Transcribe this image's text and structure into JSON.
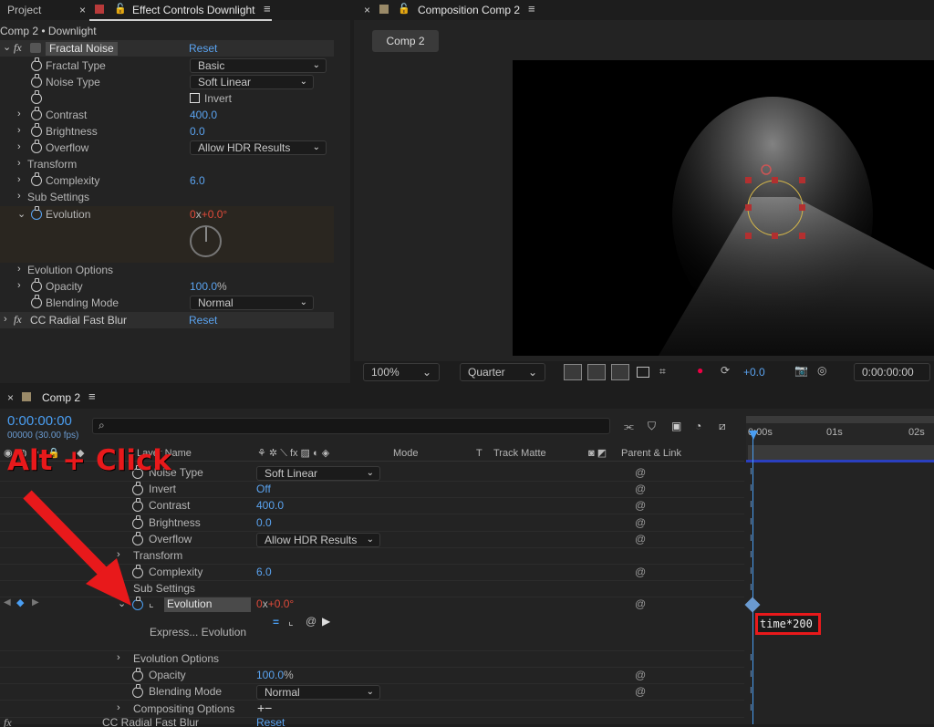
{
  "tabs": {
    "project": "Project",
    "effect_controls": "Effect Controls Downlight",
    "composition": "Composition Comp 2",
    "comp_button": "Comp 2",
    "timeline": "Comp 2"
  },
  "effect_panel": {
    "breadcrumb": "Comp 2 • Downlight",
    "effect1_name": "Fractal Noise",
    "reset": "Reset",
    "rows": {
      "fractal_type": {
        "label": "Fractal Type",
        "value": "Basic"
      },
      "noise_type": {
        "label": "Noise Type",
        "value": "Soft Linear"
      },
      "invert": {
        "label": "Invert"
      },
      "contrast": {
        "label": "Contrast",
        "value": "400.0"
      },
      "brightness": {
        "label": "Brightness",
        "value": "0.0"
      },
      "overflow": {
        "label": "Overflow",
        "value": "Allow HDR Results"
      },
      "transform": {
        "label": "Transform"
      },
      "complexity": {
        "label": "Complexity",
        "value": "6.0"
      },
      "sub_settings": {
        "label": "Sub Settings"
      },
      "evolution": {
        "label": "Evolution",
        "value_rev": "0",
        "value_x": "x",
        "value_deg": "+0.0°"
      },
      "evolution_options": {
        "label": "Evolution Options"
      },
      "opacity": {
        "label": "Opacity",
        "value": "100.0",
        "unit": "%"
      },
      "blending_mode": {
        "label": "Blending Mode",
        "value": "Normal"
      }
    },
    "effect2_name": "CC Radial Fast Blur",
    "effect2_reset": "Reset"
  },
  "comp_toolbar": {
    "zoom": "100%",
    "resolution": "Quarter",
    "exposure": "+0.0",
    "timecode": "0:00:00:00"
  },
  "timeline": {
    "timecode": "0:00:00:00",
    "frames": "00000 (30.00 fps)",
    "search_placeholder": "",
    "columns": {
      "layer_name": "Layer Name",
      "mode": "Mode",
      "t": "T",
      "track_matte": "Track Matte",
      "parent_link": "Parent & Link"
    },
    "ruler": [
      "0:00s",
      "01s",
      "02s"
    ],
    "rows": [
      {
        "label": "Noise Type",
        "value": "Soft Linear",
        "type": "dropdown"
      },
      {
        "label": "Invert",
        "value": "Off",
        "type": "text"
      },
      {
        "label": "Contrast",
        "value": "400.0",
        "type": "text"
      },
      {
        "label": "Brightness",
        "value": "0.0",
        "type": "text"
      },
      {
        "label": "Overflow",
        "value": "Allow HDR Results",
        "type": "dropdown"
      },
      {
        "label": "Transform",
        "type": "group"
      },
      {
        "label": "Complexity",
        "value": "6.0",
        "type": "text"
      },
      {
        "label": "Sub Settings",
        "type": "group"
      }
    ],
    "evolution_label": "Evolution",
    "evolution_rev": "0",
    "evolution_x": "x",
    "evolution_deg": "+0.0°",
    "expression_label": "Express... Evolution",
    "expression_text": "time*200",
    "rows2": [
      {
        "label": "Evolution Options",
        "type": "group"
      },
      {
        "label": "Opacity",
        "value": "100.0",
        "unit": "%",
        "type": "text"
      },
      {
        "label": "Blending Mode",
        "value": "Normal",
        "type": "dropdown"
      },
      {
        "label": "Compositing Options",
        "type": "group"
      }
    ],
    "partial_row": {
      "label": "CC Radial Fast Blur",
      "value": "Reset"
    }
  },
  "annotation": {
    "text": "Alt + Click",
    "color": "#e8191b"
  },
  "colors": {
    "accent_blue": "#5aa3f0",
    "value_red": "#e04a3a",
    "panel_bg": "#232323",
    "highlight_box": "#e8191b"
  }
}
